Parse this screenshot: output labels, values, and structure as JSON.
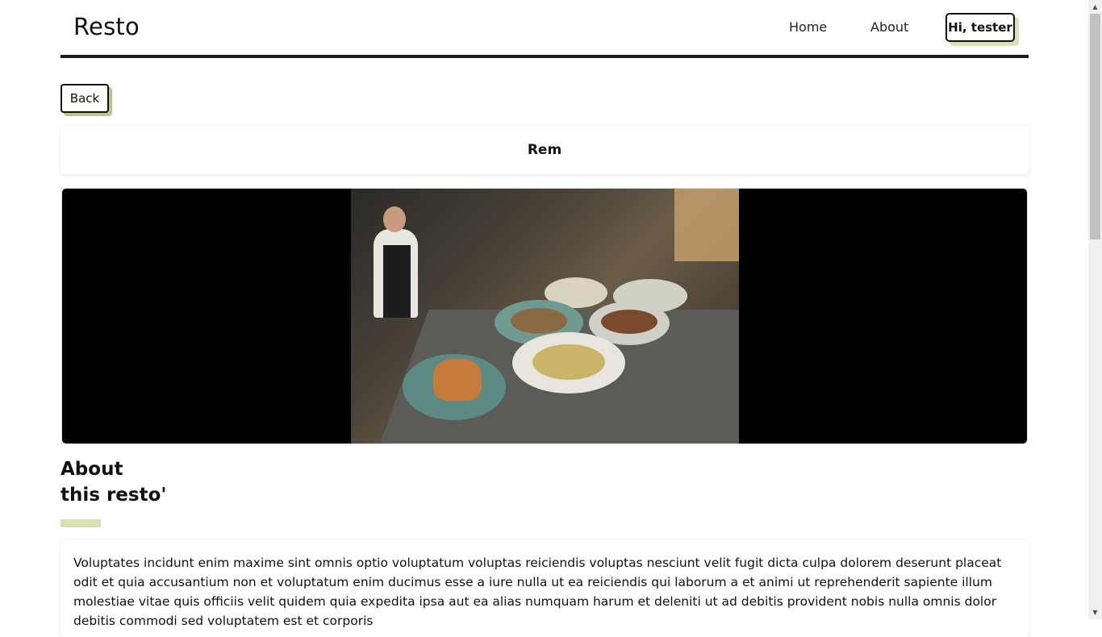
{
  "header": {
    "brand": "Resto",
    "nav": {
      "home": "Home",
      "about": "About"
    },
    "user_button": "Hi, tester"
  },
  "back_button": "Back",
  "restaurant": {
    "name": "Rem",
    "about_title_line1": "About",
    "about_title_line2": "this resto'",
    "description": "Voluptates incidunt enim maxime sint omnis optio voluptatum voluptas reiciendis voluptas nesciunt velit fugit dicta culpa dolorem deserunt placeat odit et quia accusantium non et voluptatum enim ducimus esse a iure nulla ut ea reiciendis qui laborum a et animi ut reprehenderit sapiente illum molestiae vitae quis officiis velit quidem quia expedita ipsa aut ea alias numquam harum et deleniti ut ad debitis provident nobis nulla omnis dolor debitis commodi sed voluptatem est et corporis"
  },
  "colors": {
    "accent": "#d6e2b4",
    "back_shadow": "#b3c88a",
    "header_rule": "#1a1a1a"
  },
  "icons": {
    "scroll_up": "triangle-up",
    "scroll_down": "triangle-down"
  }
}
